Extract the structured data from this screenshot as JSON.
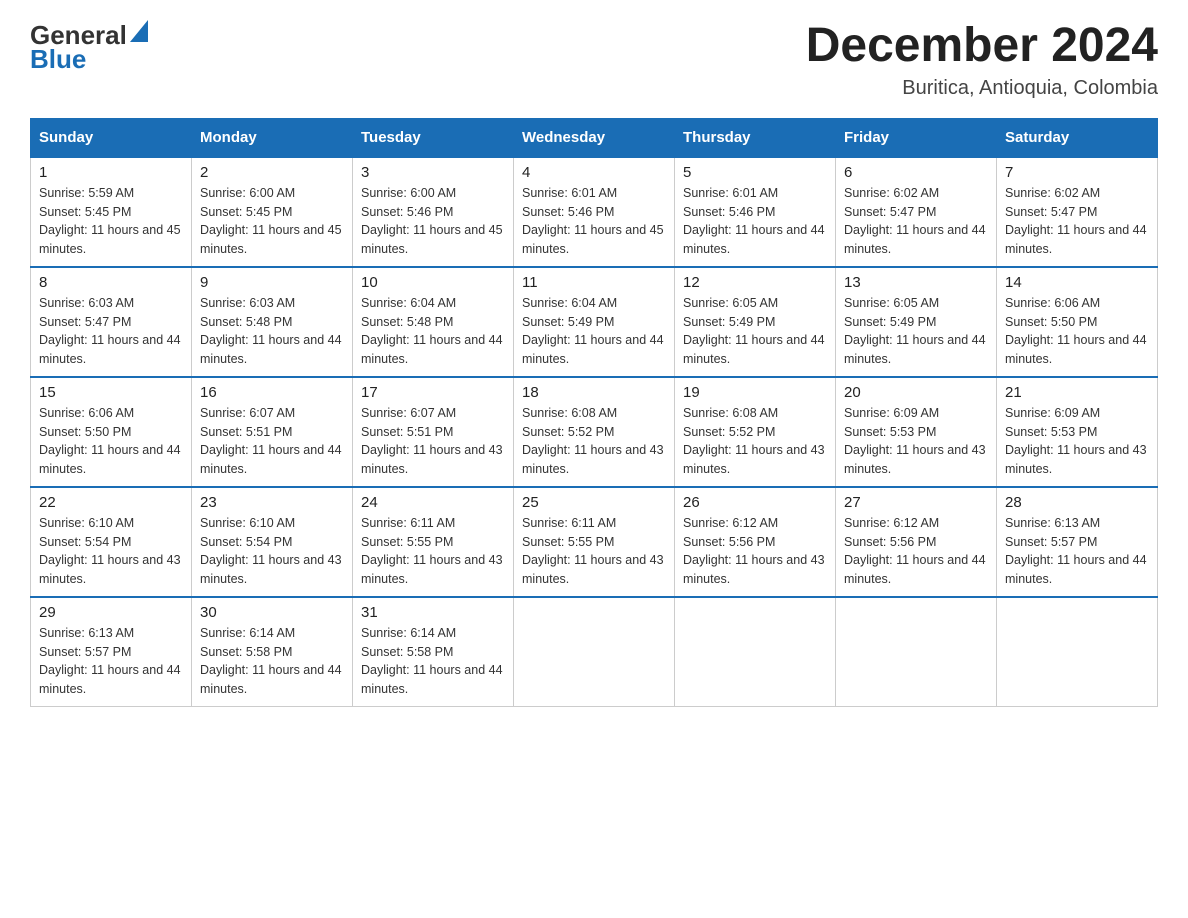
{
  "logo": {
    "general": "General",
    "blue": "Blue",
    "triangle": "▶"
  },
  "title": "December 2024",
  "subtitle": "Buritica, Antioquia, Colombia",
  "days_of_week": [
    "Sunday",
    "Monday",
    "Tuesday",
    "Wednesday",
    "Thursday",
    "Friday",
    "Saturday"
  ],
  "weeks": [
    [
      {
        "day": "1",
        "sunrise": "5:59 AM",
        "sunset": "5:45 PM",
        "daylight": "11 hours and 45 minutes."
      },
      {
        "day": "2",
        "sunrise": "6:00 AM",
        "sunset": "5:45 PM",
        "daylight": "11 hours and 45 minutes."
      },
      {
        "day": "3",
        "sunrise": "6:00 AM",
        "sunset": "5:46 PM",
        "daylight": "11 hours and 45 minutes."
      },
      {
        "day": "4",
        "sunrise": "6:01 AM",
        "sunset": "5:46 PM",
        "daylight": "11 hours and 45 minutes."
      },
      {
        "day": "5",
        "sunrise": "6:01 AM",
        "sunset": "5:46 PM",
        "daylight": "11 hours and 44 minutes."
      },
      {
        "day": "6",
        "sunrise": "6:02 AM",
        "sunset": "5:47 PM",
        "daylight": "11 hours and 44 minutes."
      },
      {
        "day": "7",
        "sunrise": "6:02 AM",
        "sunset": "5:47 PM",
        "daylight": "11 hours and 44 minutes."
      }
    ],
    [
      {
        "day": "8",
        "sunrise": "6:03 AM",
        "sunset": "5:47 PM",
        "daylight": "11 hours and 44 minutes."
      },
      {
        "day": "9",
        "sunrise": "6:03 AM",
        "sunset": "5:48 PM",
        "daylight": "11 hours and 44 minutes."
      },
      {
        "day": "10",
        "sunrise": "6:04 AM",
        "sunset": "5:48 PM",
        "daylight": "11 hours and 44 minutes."
      },
      {
        "day": "11",
        "sunrise": "6:04 AM",
        "sunset": "5:49 PM",
        "daylight": "11 hours and 44 minutes."
      },
      {
        "day": "12",
        "sunrise": "6:05 AM",
        "sunset": "5:49 PM",
        "daylight": "11 hours and 44 minutes."
      },
      {
        "day": "13",
        "sunrise": "6:05 AM",
        "sunset": "5:49 PM",
        "daylight": "11 hours and 44 minutes."
      },
      {
        "day": "14",
        "sunrise": "6:06 AM",
        "sunset": "5:50 PM",
        "daylight": "11 hours and 44 minutes."
      }
    ],
    [
      {
        "day": "15",
        "sunrise": "6:06 AM",
        "sunset": "5:50 PM",
        "daylight": "11 hours and 44 minutes."
      },
      {
        "day": "16",
        "sunrise": "6:07 AM",
        "sunset": "5:51 PM",
        "daylight": "11 hours and 44 minutes."
      },
      {
        "day": "17",
        "sunrise": "6:07 AM",
        "sunset": "5:51 PM",
        "daylight": "11 hours and 43 minutes."
      },
      {
        "day": "18",
        "sunrise": "6:08 AM",
        "sunset": "5:52 PM",
        "daylight": "11 hours and 43 minutes."
      },
      {
        "day": "19",
        "sunrise": "6:08 AM",
        "sunset": "5:52 PM",
        "daylight": "11 hours and 43 minutes."
      },
      {
        "day": "20",
        "sunrise": "6:09 AM",
        "sunset": "5:53 PM",
        "daylight": "11 hours and 43 minutes."
      },
      {
        "day": "21",
        "sunrise": "6:09 AM",
        "sunset": "5:53 PM",
        "daylight": "11 hours and 43 minutes."
      }
    ],
    [
      {
        "day": "22",
        "sunrise": "6:10 AM",
        "sunset": "5:54 PM",
        "daylight": "11 hours and 43 minutes."
      },
      {
        "day": "23",
        "sunrise": "6:10 AM",
        "sunset": "5:54 PM",
        "daylight": "11 hours and 43 minutes."
      },
      {
        "day": "24",
        "sunrise": "6:11 AM",
        "sunset": "5:55 PM",
        "daylight": "11 hours and 43 minutes."
      },
      {
        "day": "25",
        "sunrise": "6:11 AM",
        "sunset": "5:55 PM",
        "daylight": "11 hours and 43 minutes."
      },
      {
        "day": "26",
        "sunrise": "6:12 AM",
        "sunset": "5:56 PM",
        "daylight": "11 hours and 43 minutes."
      },
      {
        "day": "27",
        "sunrise": "6:12 AM",
        "sunset": "5:56 PM",
        "daylight": "11 hours and 44 minutes."
      },
      {
        "day": "28",
        "sunrise": "6:13 AM",
        "sunset": "5:57 PM",
        "daylight": "11 hours and 44 minutes."
      }
    ],
    [
      {
        "day": "29",
        "sunrise": "6:13 AM",
        "sunset": "5:57 PM",
        "daylight": "11 hours and 44 minutes."
      },
      {
        "day": "30",
        "sunrise": "6:14 AM",
        "sunset": "5:58 PM",
        "daylight": "11 hours and 44 minutes."
      },
      {
        "day": "31",
        "sunrise": "6:14 AM",
        "sunset": "5:58 PM",
        "daylight": "11 hours and 44 minutes."
      },
      null,
      null,
      null,
      null
    ]
  ]
}
